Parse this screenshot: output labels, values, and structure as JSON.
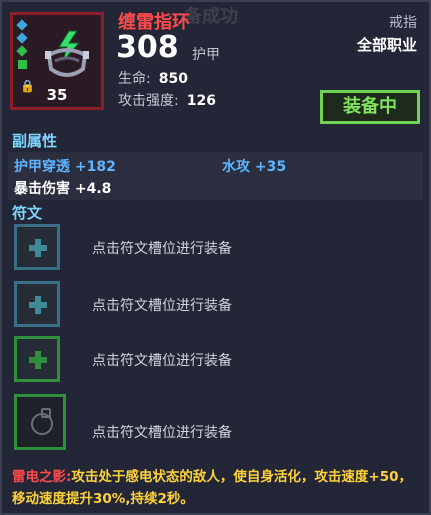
{
  "item": {
    "name": "缠雷指环",
    "ghost_text": "备成功",
    "level": "35",
    "main_stat_value": "308",
    "main_stat_label": "护甲",
    "hp_label": "生命:",
    "hp_value": "850",
    "atk_label": "攻击强度:",
    "atk_value": "126",
    "slot_type": "戒指",
    "class_req": "全部职业",
    "equip_button": "装备中"
  },
  "colors": {
    "rarity_red": "#ff4a4a",
    "equip_green": "#7fe35b",
    "section_blue": "#7fd4ff",
    "effect_gold": "#ffd23a"
  },
  "sub_attributes": {
    "header": "副属性",
    "items": [
      {
        "label": "护甲穿透 +182"
      },
      {
        "label": "水攻 +35"
      },
      {
        "label": "暴击伤害 +4.8"
      }
    ]
  },
  "runes": {
    "header": "符文",
    "slots": [
      {
        "text": "点击符文槽位进行装备",
        "icon": "plus-icon"
      },
      {
        "text": "点击符文槽位进行装备",
        "icon": "plus-icon"
      },
      {
        "text": "点击符文槽位进行装备",
        "icon": "plus-icon"
      },
      {
        "text": "点击符文槽位进行装备",
        "icon": "bomb-icon"
      }
    ]
  },
  "effect": {
    "title": "雷电之影:",
    "text": "攻击处于感电状态的敌人，使自身活化，攻击速度+50，移动速度提升30%,持续2秒。"
  }
}
